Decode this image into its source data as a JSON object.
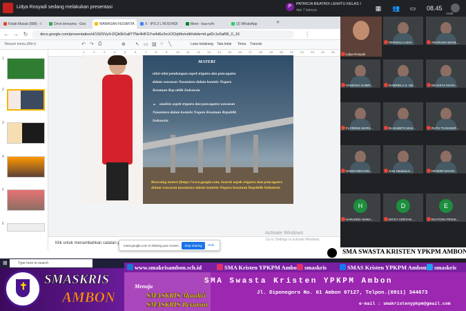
{
  "meet": {
    "presenting_text": "Lidya Rosyadi sedang melakukan presentasi",
    "presenter_chip": {
      "avatar_letter": "P",
      "name": "PATRICIA BEATRIX LEIHITU KELAS X I...",
      "sub": "dan 7 lainnya"
    },
    "clock": "08.45",
    "you_label": "Anda"
  },
  "browser": {
    "tabs": [
      {
        "label": "Kotak Masuk (898) - t",
        "color": "#ea4335"
      },
      {
        "label": "Drive bersama - Goo",
        "color": "#34a853"
      },
      {
        "label": "WAWASAN NUSANTA",
        "color": "#fbbc04",
        "active": true
      },
      {
        "label": "X - IPS 2 L ROSYADI",
        "color": "#4285f4"
      },
      {
        "label": "Meet - kaa-nzfv",
        "color": "#00832d"
      },
      {
        "label": "(3) WhatsApp",
        "color": "#25d366"
      }
    ],
    "url": "docs.google.com/presentation/d/1S0SVy4-l2Qk0kXa877Ne4HFGYw4d6z3rnX2OqMo/edit#slide=id.gd2c1e5af06_0_16"
  },
  "slides_toolbar": {
    "menu_search": "Telusuri menu (Alt+/)",
    "items": [
      "Latar belakang",
      "Tata letak",
      "Tema",
      "Transisi"
    ]
  },
  "ruler_numbers": [
    "1",
    "2",
    "3",
    "4",
    "5",
    "6",
    "7",
    "8",
    "9",
    "10",
    "11",
    "12",
    "13",
    "14",
    "15",
    "16",
    "17",
    "18",
    "19",
    "20",
    "21",
    "22",
    "23",
    "24",
    "25"
  ],
  "filmstrip": {
    "numbers": [
      "1",
      "2",
      "3",
      "4",
      "5",
      "6"
    ]
  },
  "slide": {
    "title": "MATERI",
    "lines": [
      "nilai-nilai pembangun aspek trigatra dan pancagatra",
      "dalam wawasan Nusantara dalam konteks Negara",
      "Kesatuan Rep ublik Indonesia",
      "analisis aspek trigatra dan pancagatra wawasan",
      "Nusantara dalam konteks Negara Kesatuan Republik",
      "Indonesia"
    ],
    "browse_text": "Browsing materi [https://www.google.com, Search aspek trigatra dan pancagatra dalam wawasan nusantara dalam konteks Negara kesatuan Republik Indonesia"
  },
  "notes_placeholder": "Klik untuk menambahkan catatan pembicara",
  "activate": {
    "title": "Activate Windows",
    "sub": "Go to Settings to activate Windows."
  },
  "share": {
    "text": "meet.google.com is sharing your screen.",
    "stop": "Stop sharing",
    "hide": "Hide"
  },
  "taskbar": {
    "search_placeholder": "Type here to search"
  },
  "participants": [
    {
      "name": "Lidya Rosyadi",
      "type": "big"
    },
    {
      "name": "PERSKILA LEIH...",
      "type": "video"
    },
    {
      "name": "ANGRAINI WONL...",
      "type": "video"
    },
    {
      "name": "VANESSA GABRI...",
      "type": "video"
    },
    {
      "name": "GABRIELA S. UB...",
      "type": "video"
    },
    {
      "name": "EKLESYA MAHU...",
      "type": "video"
    },
    {
      "name": "FLORENS MARS...",
      "type": "video"
    },
    {
      "name": "ELISABETH MAK...",
      "type": "video"
    },
    {
      "name": "RUTH TUHUMUR...",
      "type": "video"
    },
    {
      "name": "SANDI MICHAEL...",
      "type": "video"
    },
    {
      "name": "Jose Hauissa K...",
      "type": "video"
    },
    {
      "name": "HENDRI NAYAN...",
      "type": "video"
    },
    {
      "name": "HARLEND HUWA...",
      "type": "letter",
      "letter": "H",
      "color": "#1e8e3e"
    },
    {
      "name": "DICKY ARDYAN ...",
      "type": "letter",
      "letter": "D",
      "color": "#1e8e3e"
    },
    {
      "name": "ELVYONA PESUL...",
      "type": "letter",
      "letter": "E",
      "color": "#1e8e3e"
    }
  ],
  "present_banner": {
    "school": "SMA SWASTA KRISTEN YPKPM AMBON"
  },
  "banner": {
    "social": {
      "web": "www.smakrisambon.sch.id",
      "ig1": "SMA Kristen YPKPM Ambon",
      "ig2": "smaskris",
      "fb": "SMAS Kristen YPKPM Ambon",
      "tw": "smaskris"
    },
    "logo_text": "SMASKRIS",
    "brand1": "SMASKRIS",
    "brand2": "AMBON",
    "menuju": "Menuju",
    "motto1": "SMASKRIS Mandiri",
    "motto2": "SMASKRIS Bermutu",
    "school_full": "SMA Swasta Kristen YPKPM Ambon",
    "address": "Jl. Diponegoro  No. 61 Ambon 97127, Telpon.(0911) 344673",
    "email": "e-mail : smakristenypkpm@gmail.com"
  }
}
